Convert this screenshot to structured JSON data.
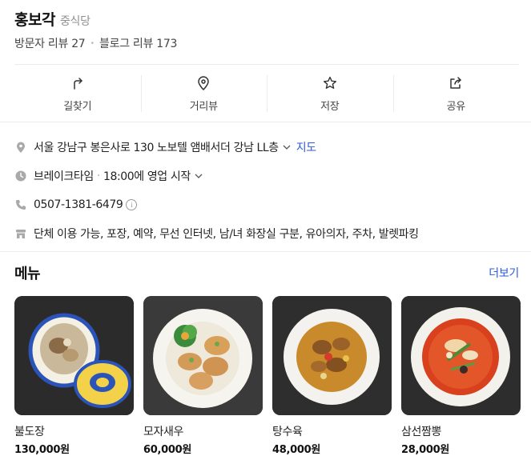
{
  "place": {
    "name": "홍보각",
    "category": "중식당",
    "visitor_reviews": "방문자 리뷰 27",
    "blog_reviews": "블로그 리뷰 173"
  },
  "actions": [
    {
      "label": "길찾기",
      "icon": "directions-icon"
    },
    {
      "label": "거리뷰",
      "icon": "location-pin-icon"
    },
    {
      "label": "저장",
      "icon": "star-icon"
    },
    {
      "label": "공유",
      "icon": "share-icon"
    }
  ],
  "info": {
    "address": "서울 강남구 봉은사로 130 노보텔 앰배서더 강남 LL층",
    "map_link": "지도",
    "hours_status": "브레이크타임",
    "hours_detail": "18:00에 영업 시작",
    "phone": "0507-1381-6479",
    "info_icon_text": "i",
    "amenities": "단체 이용 가능, 포장, 예약, 무선 인터넷, 남/녀 화장실 구분, 유아의자, 주차, 발렛파킹"
  },
  "menu": {
    "title": "메뉴",
    "more": "더보기",
    "items": [
      {
        "name": "불도장",
        "price": "130,000원"
      },
      {
        "name": "모자새우",
        "price": "60,000원"
      },
      {
        "name": "탕수육",
        "price": "48,000원"
      },
      {
        "name": "삼선짬뽕",
        "price": "28,000원"
      }
    ]
  },
  "colors": {
    "link": "#2d5bd8",
    "divider": "#ececec",
    "dish_background": "#2b2b2b"
  }
}
